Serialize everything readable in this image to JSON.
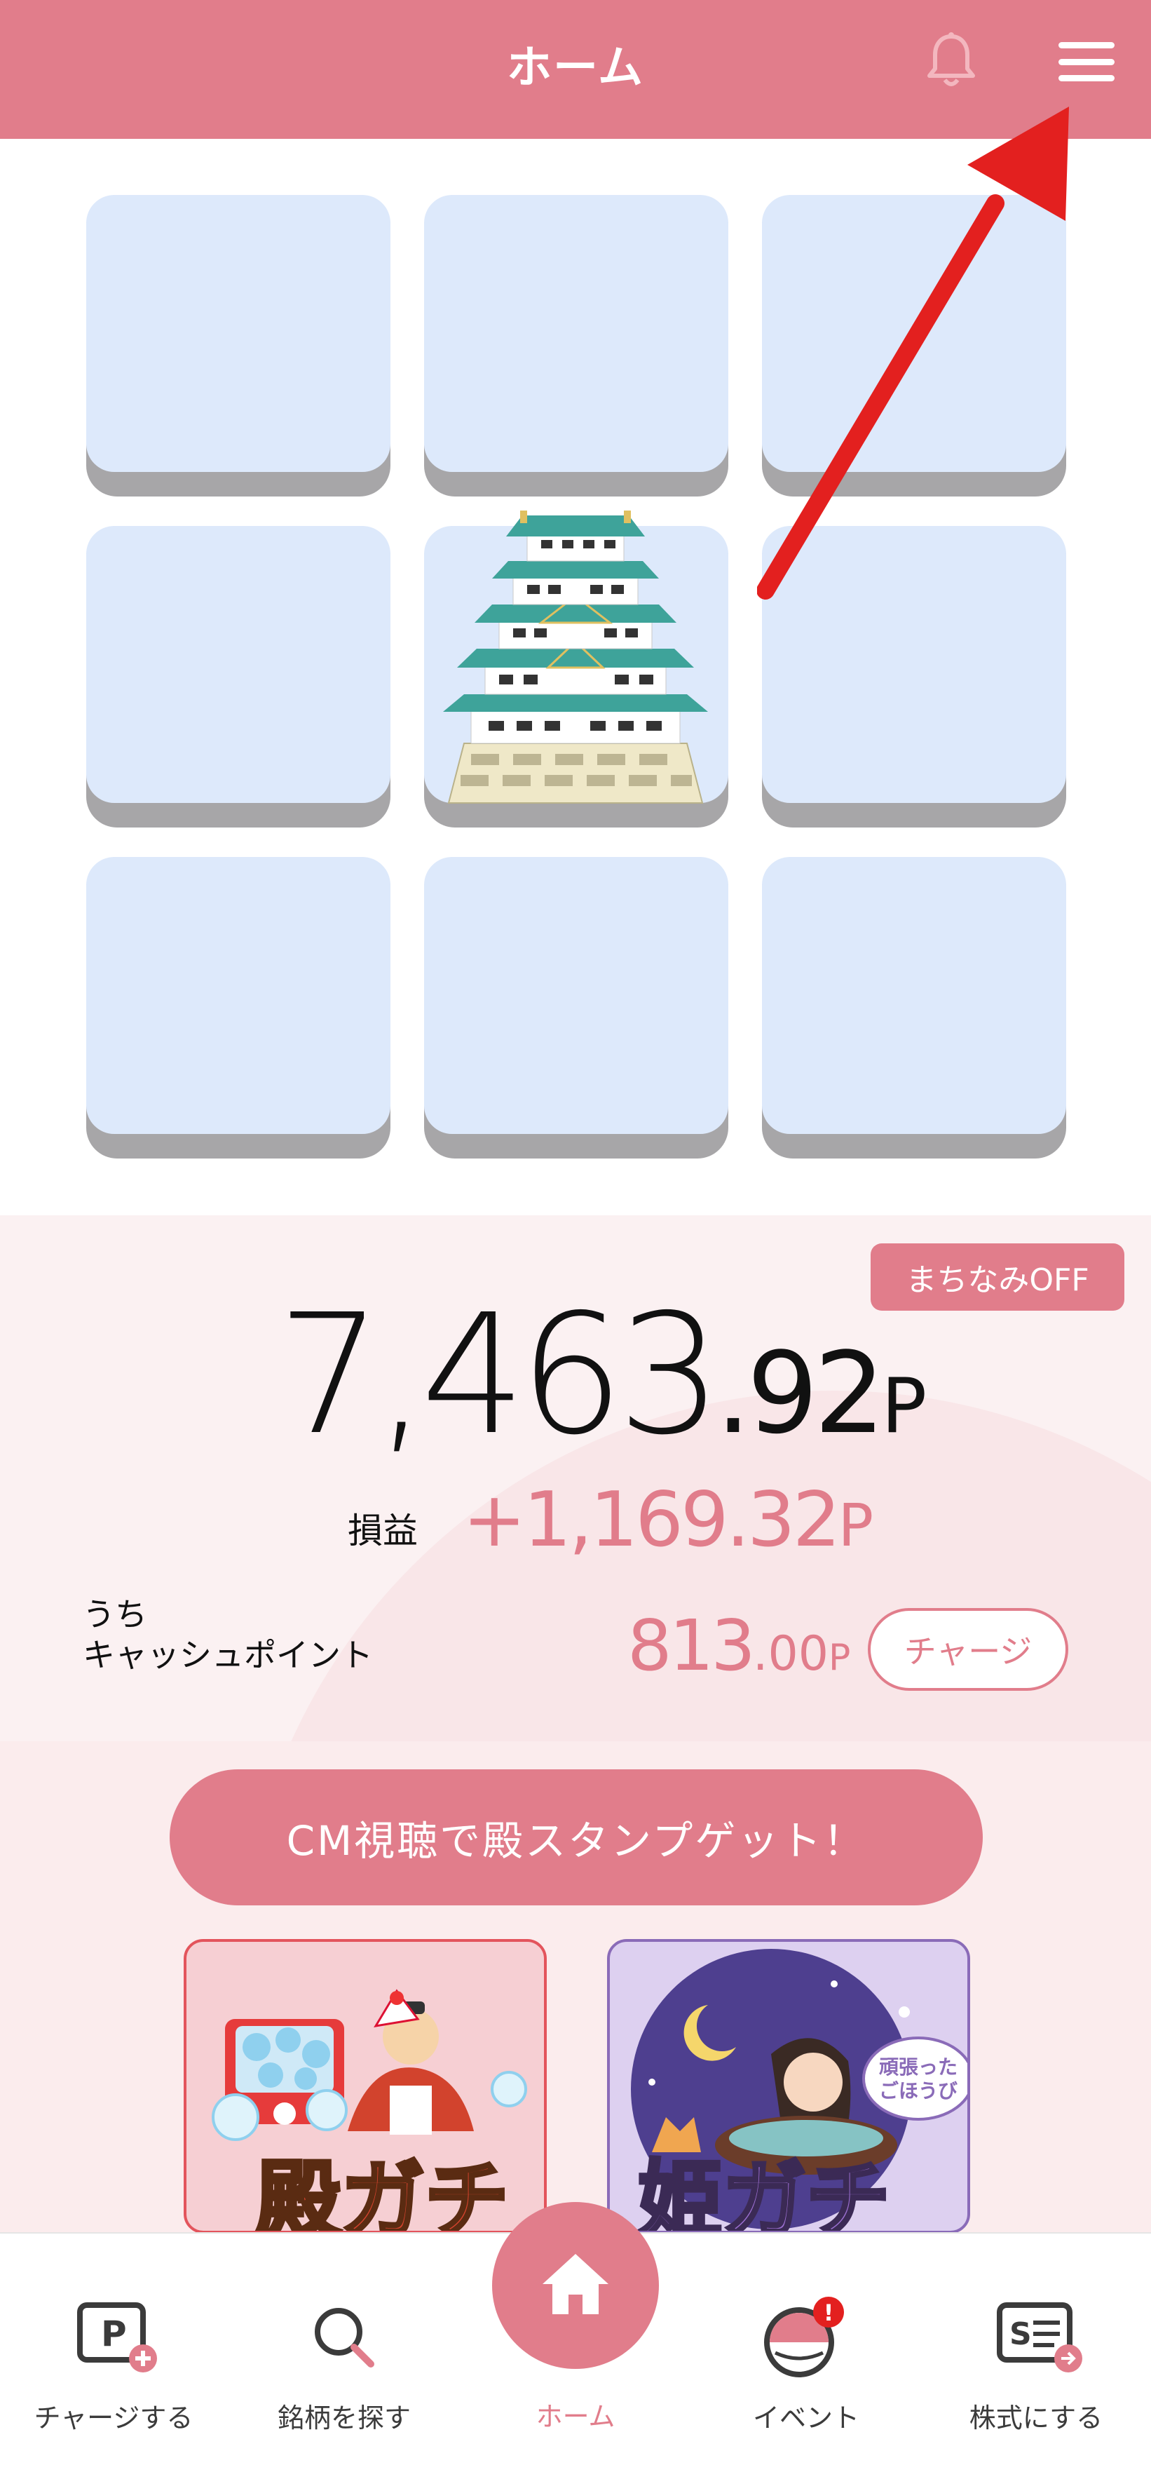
{
  "header": {
    "title": "ホーム",
    "bell_icon": "bell-icon",
    "menu_icon": "hamburger-menu-icon"
  },
  "colors": {
    "primary": "#e17d8b",
    "tile_face": "#dde9fb",
    "tile_base": "#a7a6a8",
    "arrow": "#e3201f"
  },
  "stamp_grid": {
    "rows": 3,
    "cols": 3,
    "filled_cells": [
      4
    ],
    "stamp_icon": "castle-icon"
  },
  "points": {
    "machinami_label": "まちなみOFF",
    "total_int": "7,463",
    "total_dec": ".92",
    "total_unit": "P",
    "profit_label": "損益",
    "profit_value": "+1,169.32",
    "profit_unit": "P",
    "cash_label_line1": "うち",
    "cash_label_line2": "キャッシュポイント",
    "cash_int": "813",
    "cash_dec": ".00",
    "cash_unit": "P",
    "charge_button": "チャージ"
  },
  "cm_button": "CM視聴で殿スタンプゲット！",
  "gacha": {
    "tono_title_chars": "殿ガチ",
    "hime_title_chars": "姫ガチ",
    "hime_badge_line1": "頑張った",
    "hime_badge_line2": "ごほうび"
  },
  "bottom_nav": {
    "items": [
      {
        "label": "チャージする",
        "icon": "charge-icon"
      },
      {
        "label": "銘柄を探す",
        "icon": "search-icon"
      },
      {
        "label": "ホーム",
        "icon": "home-icon",
        "active": true
      },
      {
        "label": "イベント",
        "icon": "event-icon",
        "badge": "!"
      },
      {
        "label": "株式にする",
        "icon": "stock-convert-icon"
      }
    ]
  }
}
